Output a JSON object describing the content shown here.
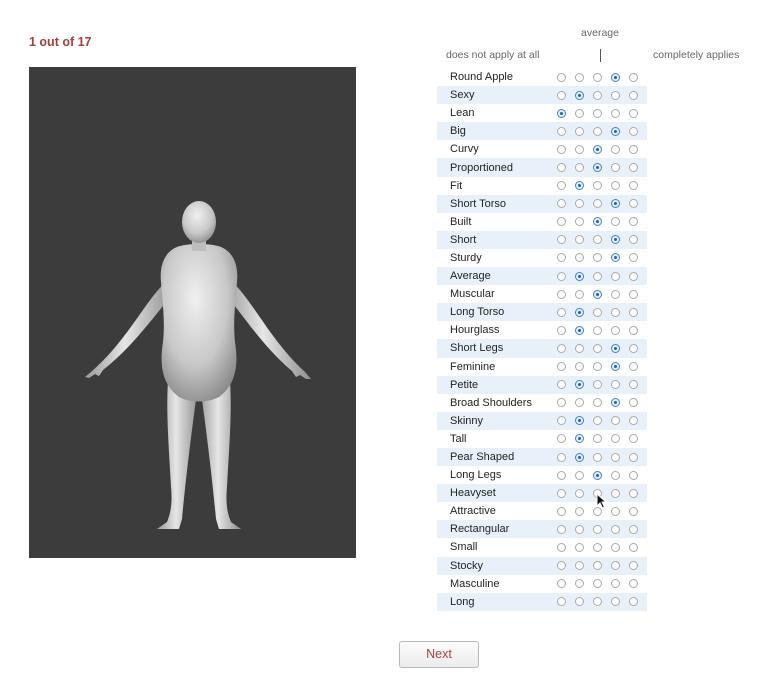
{
  "survey": {
    "counter": "1 out of 17",
    "scale": {
      "average_label": "average",
      "left_label": "does not apply at all",
      "right_label": "completely applies",
      "tick_mark": "|"
    },
    "items": [
      {
        "label": "Round Apple",
        "selected": 4
      },
      {
        "label": "Sexy",
        "selected": 2
      },
      {
        "label": "Lean",
        "selected": 1
      },
      {
        "label": "Big",
        "selected": 4
      },
      {
        "label": "Curvy",
        "selected": 3
      },
      {
        "label": "Proportioned",
        "selected": 3
      },
      {
        "label": "Fit",
        "selected": 2
      },
      {
        "label": "Short Torso",
        "selected": 4
      },
      {
        "label": "Built",
        "selected": 3
      },
      {
        "label": "Short",
        "selected": 4
      },
      {
        "label": "Sturdy",
        "selected": 4
      },
      {
        "label": "Average",
        "selected": 2
      },
      {
        "label": "Muscular",
        "selected": 3
      },
      {
        "label": "Long Torso",
        "selected": 2
      },
      {
        "label": "Hourglass",
        "selected": 2
      },
      {
        "label": "Short Legs",
        "selected": 4
      },
      {
        "label": "Feminine",
        "selected": 4
      },
      {
        "label": "Petite",
        "selected": 2
      },
      {
        "label": "Broad Shoulders",
        "selected": 4
      },
      {
        "label": "Skinny",
        "selected": 2
      },
      {
        "label": "Tall",
        "selected": 2
      },
      {
        "label": "Pear Shaped",
        "selected": 2
      },
      {
        "label": "Long Legs",
        "selected": 3
      },
      {
        "label": "Heavyset",
        "selected": 0
      },
      {
        "label": "Attractive",
        "selected": 0
      },
      {
        "label": "Rectangular",
        "selected": 0
      },
      {
        "label": "Small",
        "selected": 0
      },
      {
        "label": "Stocky",
        "selected": 0
      },
      {
        "label": "Masculine",
        "selected": 0
      },
      {
        "label": "Long",
        "selected": 0
      }
    ],
    "options_per_item": 5,
    "next_label": "Next"
  },
  "colors": {
    "accent": "#a0403f",
    "row_highlight": "#e8f1fa",
    "radio_selected": "#1d62b8",
    "viewer_bg": "#3c3c3c"
  },
  "icons": {
    "cursor": "mouse-pointer-icon",
    "figure": "3d-body-model"
  }
}
